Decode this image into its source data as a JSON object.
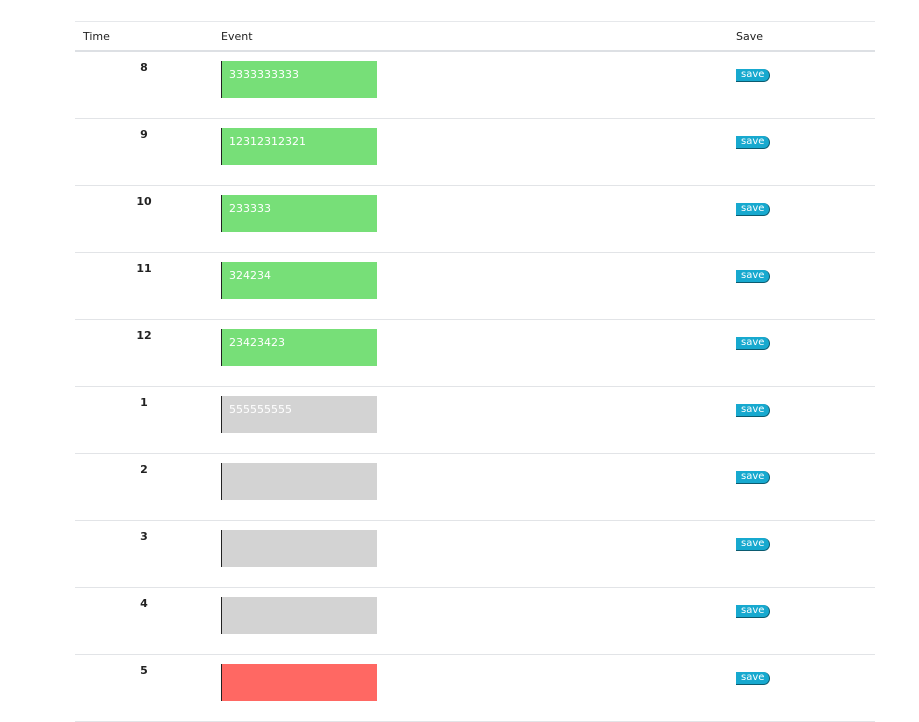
{
  "headers": {
    "time": "Time",
    "event": "Event",
    "save": "Save"
  },
  "colors": {
    "done": "#77df78",
    "pending": "#d3d3d3",
    "alert": "#ff6863",
    "save_button": "#17a9cf"
  },
  "rows": [
    {
      "time": "8",
      "event": "3333333333",
      "status": "done",
      "save": "save"
    },
    {
      "time": "9",
      "event": "12312312321",
      "status": "done",
      "save": "save"
    },
    {
      "time": "10",
      "event": "233333",
      "status": "done",
      "save": "save"
    },
    {
      "time": "11",
      "event": "324234",
      "status": "done",
      "save": "save"
    },
    {
      "time": "12",
      "event": "23423423",
      "status": "done",
      "save": "save"
    },
    {
      "time": "1",
      "event": "555555555",
      "status": "pending",
      "save": "save"
    },
    {
      "time": "2",
      "event": "",
      "status": "pending",
      "save": "save"
    },
    {
      "time": "3",
      "event": "",
      "status": "pending",
      "save": "save"
    },
    {
      "time": "4",
      "event": "",
      "status": "pending",
      "save": "save"
    },
    {
      "time": "5",
      "event": "",
      "status": "alert",
      "save": "save"
    }
  ]
}
